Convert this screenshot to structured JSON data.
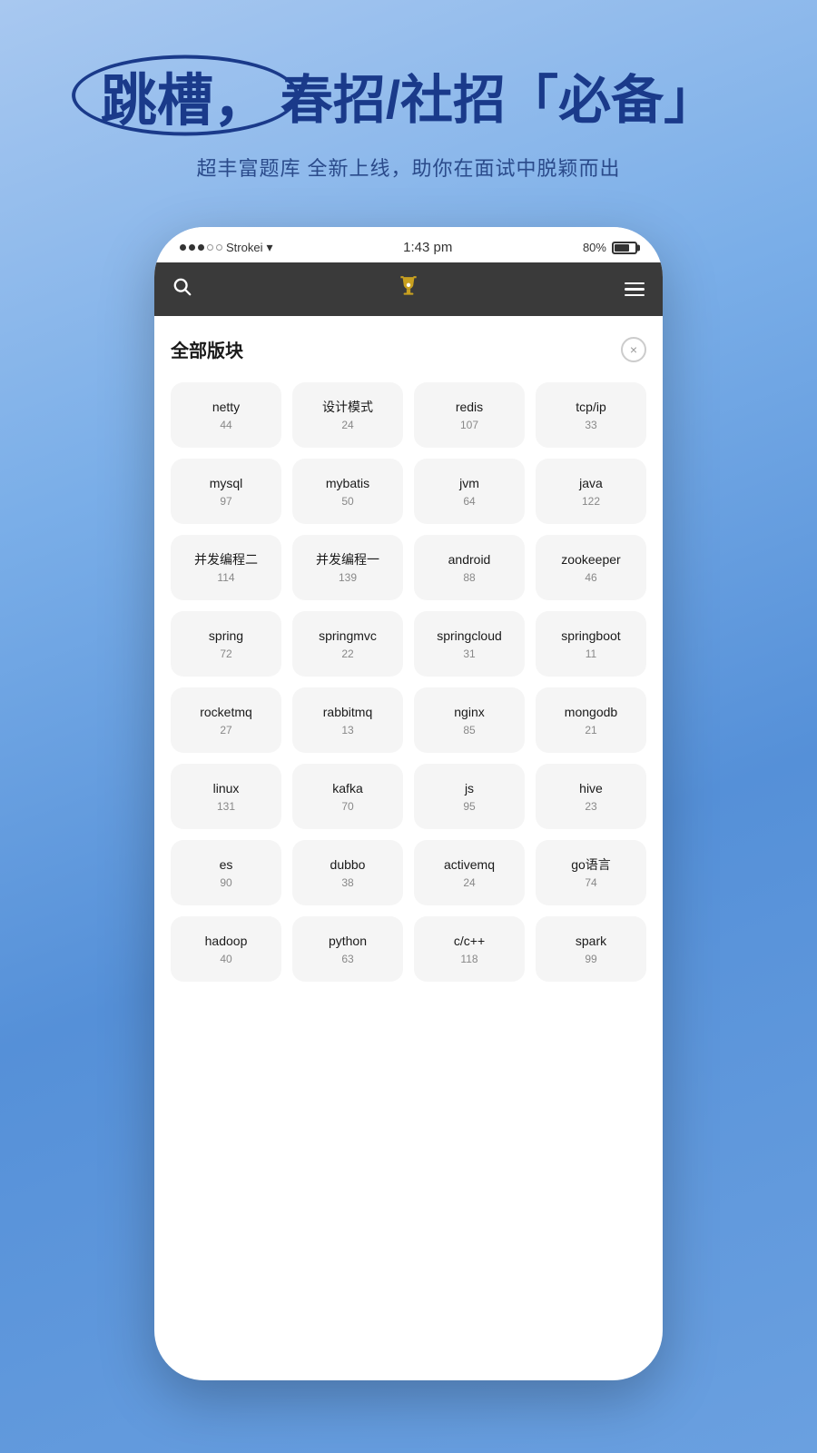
{
  "background": {
    "gradient_start": "#a8c8f0",
    "gradient_end": "#6aa0e0"
  },
  "header": {
    "headline_jump": "跳槽，",
    "headline_sub": "春招/社招",
    "headline_bracket_open": "「",
    "headline_must": "必备",
    "headline_bracket_close": "」",
    "subtitle": "超丰富题库 全新上线，助你在面试中脱颖而出"
  },
  "status_bar": {
    "signal_label": "Strokei",
    "time": "1:43 pm",
    "battery": "80%"
  },
  "navbar": {
    "search_icon": "⌕",
    "menu_icon": "≡"
  },
  "panel": {
    "title": "全部版块",
    "close_icon": "×",
    "items": [
      {
        "name": "netty",
        "count": "44"
      },
      {
        "name": "设计模式",
        "count": "24"
      },
      {
        "name": "redis",
        "count": "107"
      },
      {
        "name": "tcp/ip",
        "count": "33"
      },
      {
        "name": "mysql",
        "count": "97"
      },
      {
        "name": "mybatis",
        "count": "50"
      },
      {
        "name": "jvm",
        "count": "64"
      },
      {
        "name": "java",
        "count": "122"
      },
      {
        "name": "并发编程二",
        "count": "114"
      },
      {
        "name": "并发编程一",
        "count": "139"
      },
      {
        "name": "android",
        "count": "88"
      },
      {
        "name": "zookeeper",
        "count": "46"
      },
      {
        "name": "spring",
        "count": "72"
      },
      {
        "name": "springmvc",
        "count": "22"
      },
      {
        "name": "springcloud",
        "count": "31"
      },
      {
        "name": "springboot",
        "count": "11"
      },
      {
        "name": "rocketmq",
        "count": "27"
      },
      {
        "name": "rabbitmq",
        "count": "13"
      },
      {
        "name": "nginx",
        "count": "85"
      },
      {
        "name": "mongodb",
        "count": "21"
      },
      {
        "name": "linux",
        "count": "131"
      },
      {
        "name": "kafka",
        "count": "70"
      },
      {
        "name": "js",
        "count": "95"
      },
      {
        "name": "hive",
        "count": "23"
      },
      {
        "name": "es",
        "count": "90"
      },
      {
        "name": "dubbo",
        "count": "38"
      },
      {
        "name": "activemq",
        "count": "24"
      },
      {
        "name": "go语言",
        "count": "74"
      },
      {
        "name": "hadoop",
        "count": "40"
      },
      {
        "name": "python",
        "count": "63"
      },
      {
        "name": "c/c++",
        "count": "118"
      },
      {
        "name": "spark",
        "count": "99"
      }
    ]
  }
}
